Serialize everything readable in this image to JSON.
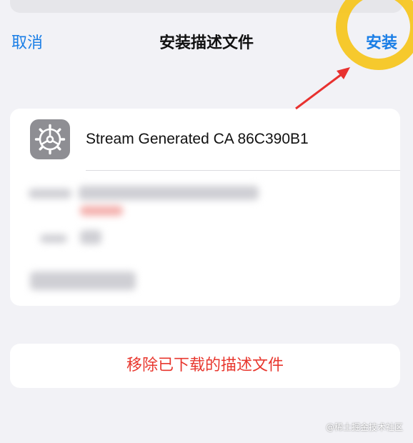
{
  "nav": {
    "cancel_label": "取消",
    "title": "安装描述文件",
    "install_label": "安装"
  },
  "profile": {
    "name": "Stream Generated CA 86C390B1",
    "icon": "gear-icon"
  },
  "actions": {
    "remove_label": "移除已下载的描述文件"
  },
  "annotation": {
    "highlight_color": "#f6c51b",
    "arrow_color": "#e8312f"
  },
  "colors": {
    "accent": "#1a7ee6",
    "destructive": "#e8372e",
    "background": "#f2f2f6"
  },
  "watermark": "@稀土掘金技术社区"
}
